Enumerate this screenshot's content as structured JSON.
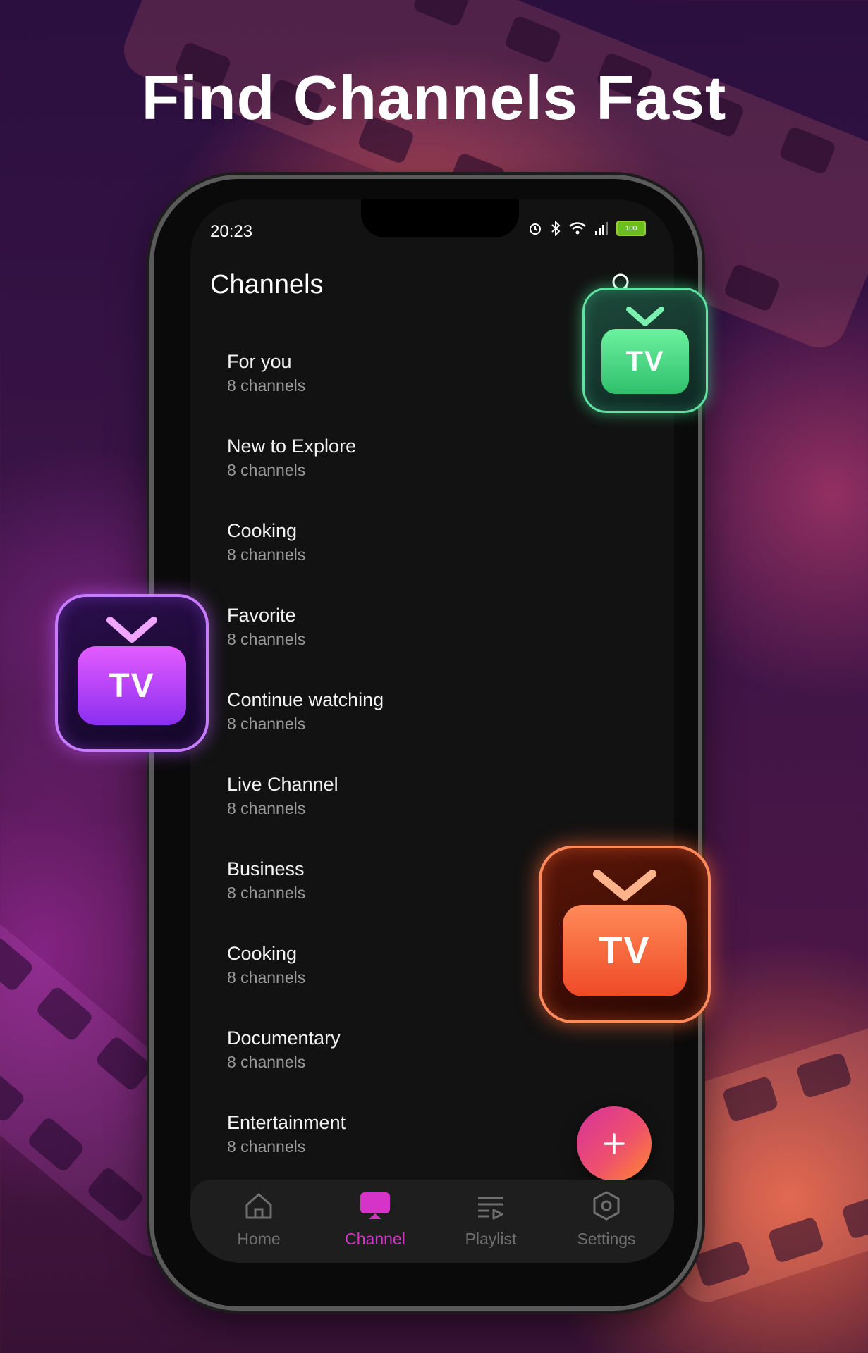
{
  "headline": "Find Channels Fast",
  "status": {
    "time": "20:23",
    "battery": "100"
  },
  "screen_title": "Channels",
  "channels": [
    {
      "name": "For you",
      "count": "8 channels"
    },
    {
      "name": "New to Explore",
      "count": "8 channels"
    },
    {
      "name": "Cooking",
      "count": "8 channels"
    },
    {
      "name": "Favorite",
      "count": "8 channels"
    },
    {
      "name": "Continue watching",
      "count": "8 channels"
    },
    {
      "name": "Live Channel",
      "count": "8 channels"
    },
    {
      "name": "Business",
      "count": "8 channels"
    },
    {
      "name": "Cooking",
      "count": "8 channels"
    },
    {
      "name": "Documentary",
      "count": "8 channels"
    },
    {
      "name": "Entertainment",
      "count": "8 channels"
    }
  ],
  "nav": {
    "home": "Home",
    "channel": "Channel",
    "playlist": "Playlist",
    "settings": "Settings",
    "active": "Channel"
  },
  "badges": {
    "green_label": "TV",
    "purple_label": "TV",
    "orange_label": "TV"
  },
  "colors": {
    "accent": "#d633c9",
    "fab_start": "#d6329c",
    "fab_end": "#ff8a2e",
    "badge_green": "#3fd27a",
    "badge_purple": "#a63cf0",
    "badge_orange": "#ff5a2e"
  },
  "icons": {
    "fab": "plus-icon",
    "search": "search-icon",
    "home": "home-icon",
    "channel": "tv-screen-icon",
    "playlist": "playlist-icon",
    "settings": "hexagon-settings-icon"
  }
}
